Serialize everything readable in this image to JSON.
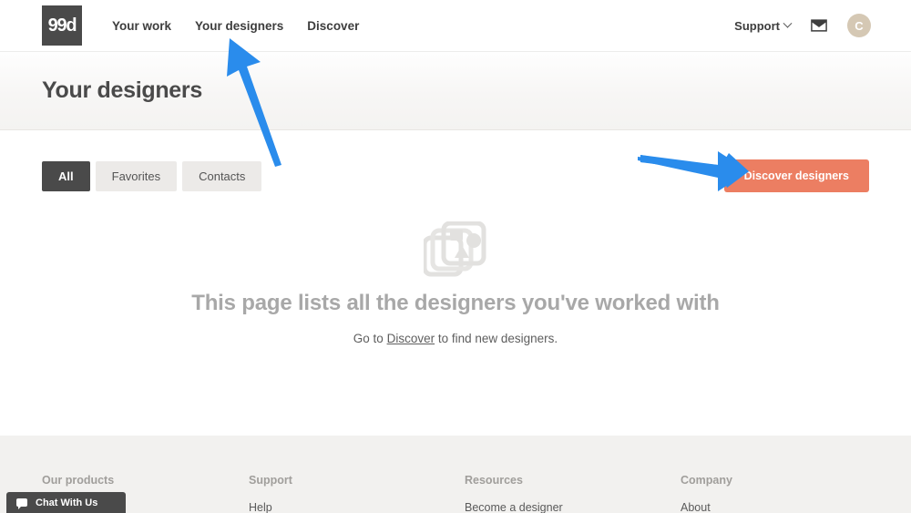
{
  "header": {
    "logo_text": "99d",
    "nav": [
      {
        "label": "Your work",
        "name": "nav-your-work"
      },
      {
        "label": "Your designers",
        "name": "nav-your-designers"
      },
      {
        "label": "Discover",
        "name": "nav-discover"
      }
    ],
    "support_label": "Support",
    "avatar_initial": "C",
    "icons": {
      "chevron": "chevron-down-icon",
      "mail": "mail-icon",
      "avatar": "avatar"
    }
  },
  "page": {
    "title": "Your designers"
  },
  "toolbar": {
    "tabs": [
      {
        "label": "All",
        "active": true
      },
      {
        "label": "Favorites",
        "active": false
      },
      {
        "label": "Contacts",
        "active": false
      }
    ],
    "discover_button": "Discover designers"
  },
  "empty_state": {
    "icon": "image-stack-icon",
    "heading": "This page lists all the designers you've worked with",
    "sub_prefix": "Go to ",
    "sub_link": "Discover",
    "sub_suffix": " to find new designers."
  },
  "footer": {
    "columns": [
      {
        "heading": "Our products",
        "links": []
      },
      {
        "heading": "Support",
        "links": [
          "Help"
        ]
      },
      {
        "heading": "Resources",
        "links": [
          "Become a designer"
        ]
      },
      {
        "heading": "Company",
        "links": [
          "About"
        ]
      }
    ]
  },
  "chat_widget": {
    "label": "Chat With Us",
    "icon": "chat-bubble-icon"
  },
  "annotations": [
    {
      "name": "arrow-to-your-designers",
      "target": "Your designers",
      "direction": "up-left"
    },
    {
      "name": "arrow-to-discover-designers",
      "target": "Discover designers",
      "direction": "right"
    }
  ],
  "colors": {
    "accent_button": "#ec7e62",
    "annotation_arrow": "#2a8cec",
    "logo_bg": "#4a4a4a",
    "footer_bg": "#f2f1ef",
    "avatar_bg": "#d5c8b4"
  }
}
